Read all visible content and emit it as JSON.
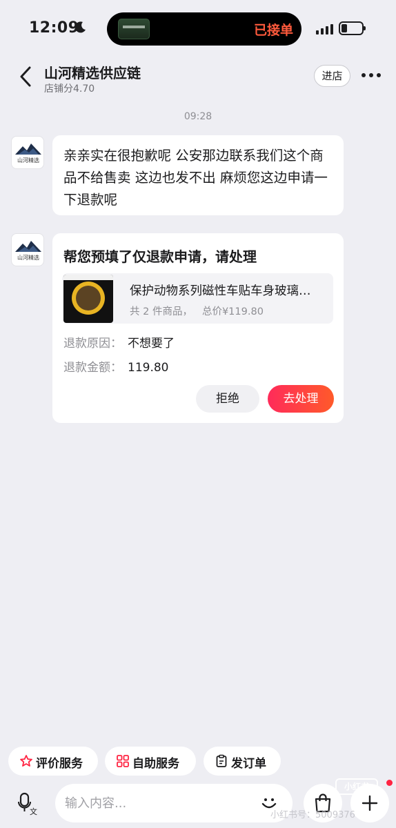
{
  "status_bar": {
    "time": "12:09",
    "island_status": "已接单",
    "icons": [
      "moon-icon",
      "signal-icon",
      "battery-icon"
    ]
  },
  "header": {
    "shop_name": "山河精选供应链",
    "shop_score": "店铺分4.70",
    "enter_store_label": "进店"
  },
  "chat": {
    "timestamp": "09:28",
    "avatar_text": "山河精选",
    "message_text": "亲亲实在很抱歉呢 公安那边联系我们这个商品不给售卖 这边也发不出 麻烦您这边申请一下退款呢",
    "card": {
      "title": "帮您预填了仅退款申请，请处理",
      "product_title": "保护动物系列磁性车贴车身玻璃…",
      "item_count": "共 2 件商品，",
      "total_price": "总价¥119.80",
      "reason_label": "退款原因：",
      "reason_value": "不想要了",
      "amount_label": "退款金额：",
      "amount_value": "119.80",
      "reject_label": "拒绝",
      "process_label": "去处理"
    }
  },
  "quick_actions": [
    {
      "label": "评价服务",
      "icon": "star-flower-icon"
    },
    {
      "label": "自助服务",
      "icon": "grid-icon"
    },
    {
      "label": "发订单",
      "icon": "clipboard-icon"
    }
  ],
  "input": {
    "placeholder": "输入内容..."
  },
  "watermark": {
    "logo": "小红书",
    "text": "小红书号：5009376"
  },
  "colors": {
    "accent_gradient_start": "#ff2b5a",
    "accent_gradient_end": "#ff5a2a",
    "island_status": "#ff5a3c",
    "background": "#eeeef3"
  }
}
